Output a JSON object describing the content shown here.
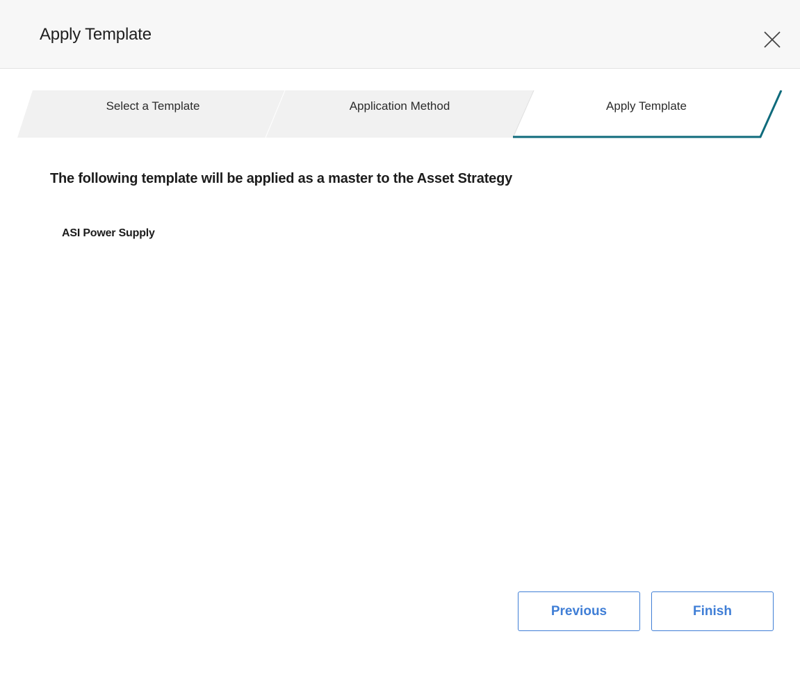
{
  "dialog": {
    "title": "Apply Template",
    "close_icon": "close-icon"
  },
  "wizard": {
    "steps": [
      {
        "label": "Select a Template",
        "state": "inactive"
      },
      {
        "label": "Application Method",
        "state": "inactive"
      },
      {
        "label": "Apply Template",
        "state": "active"
      }
    ],
    "active_color": "#0f6b7c",
    "inactive_color": "#f1f1f1"
  },
  "content": {
    "heading": "The following template will be applied as a master to the Asset Strategy",
    "template_name": "ASI Power Supply"
  },
  "footer": {
    "previous_label": "Previous",
    "finish_label": "Finish",
    "button_color": "#3f7ed6"
  }
}
